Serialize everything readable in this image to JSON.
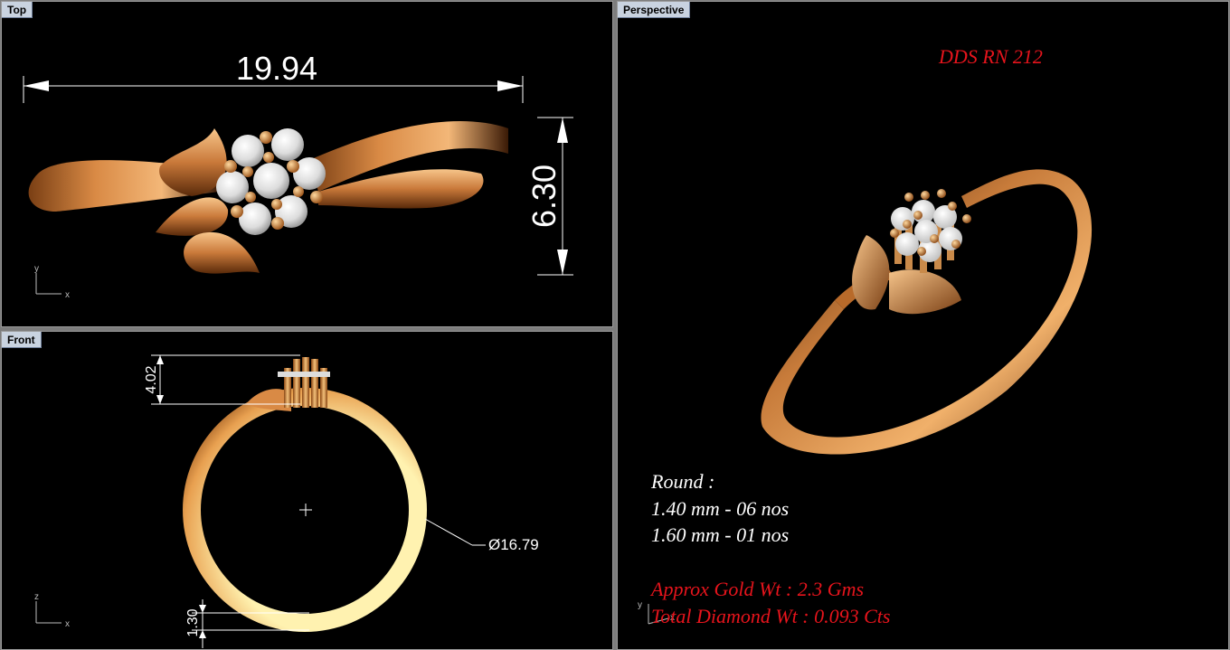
{
  "viewports": {
    "top": {
      "label": "Top"
    },
    "front": {
      "label": "Front"
    },
    "perspective": {
      "label": "Perspective"
    }
  },
  "dimensions": {
    "top_width": "19.94",
    "top_height": "6.30",
    "front_height": "4.02",
    "front_diameter": "Ø16.79",
    "front_thickness": "1.30"
  },
  "axes": {
    "top": {
      "v": "y",
      "h": "x"
    },
    "front": {
      "v": "z",
      "h": "x"
    },
    "perspective": {
      "v": "y",
      "h": "x"
    }
  },
  "design_code": "DDS RN 212",
  "specs": {
    "shape": "Round :",
    "line1": "1.40 mm - 06 nos",
    "line2": "1.60 mm - 01 nos",
    "gold_weight": "Approx Gold Wt : 2.3 Gms",
    "diamond_weight": "Total Diamond Wt : 0.093 Cts"
  },
  "colors": {
    "viewport_bg": "#000000",
    "gold": "#c47a3a",
    "diamond": "#e8e8e8",
    "red_text": "#e6141c"
  }
}
